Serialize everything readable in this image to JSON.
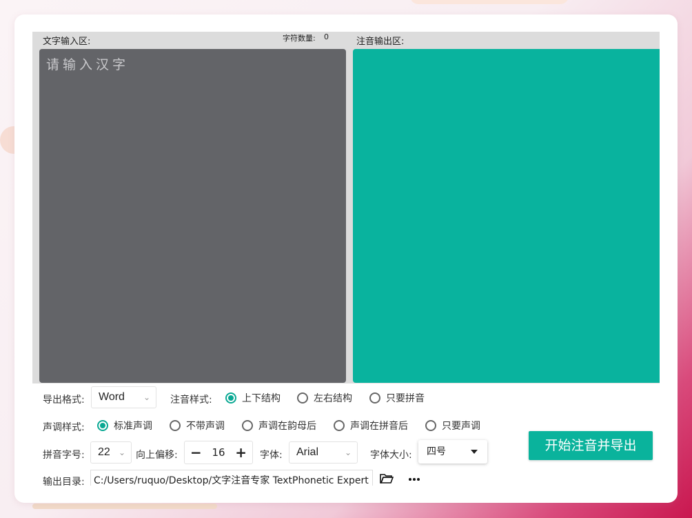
{
  "input": {
    "label": "文字输入区:",
    "char_count_label": "字符数量:",
    "char_count": "0",
    "placeholder": "请输入汉字"
  },
  "output": {
    "label": "注音输出区:"
  },
  "export_format": {
    "label": "导出格式:",
    "value": "Word"
  },
  "annotation_style": {
    "label": "注音样式:",
    "options": [
      "上下结构",
      "左右结构",
      "只要拼音"
    ],
    "selected": 0
  },
  "tone_style": {
    "label": "声调样式:",
    "options": [
      "标准声调",
      "不带声调",
      "声调在韵母后",
      "声调在拼音后",
      "只要声调"
    ],
    "selected": 0
  },
  "pinyin_size": {
    "label": "拼音字号:",
    "value": "22"
  },
  "offset": {
    "label": "向上偏移:",
    "minus": "−",
    "value": "16",
    "plus": "+"
  },
  "font": {
    "label": "字体:",
    "value": "Arial"
  },
  "font_size": {
    "label": "字体大小:",
    "value": "四号"
  },
  "start_button": "开始注音并导出",
  "output_dir": {
    "label": "输出目录:",
    "value": "C:/Users/ruquo/Desktop/文字注音专家 TextPhonetic Expert"
  },
  "colors": {
    "accent": "#09b39e",
    "input_bg": "#636468"
  }
}
